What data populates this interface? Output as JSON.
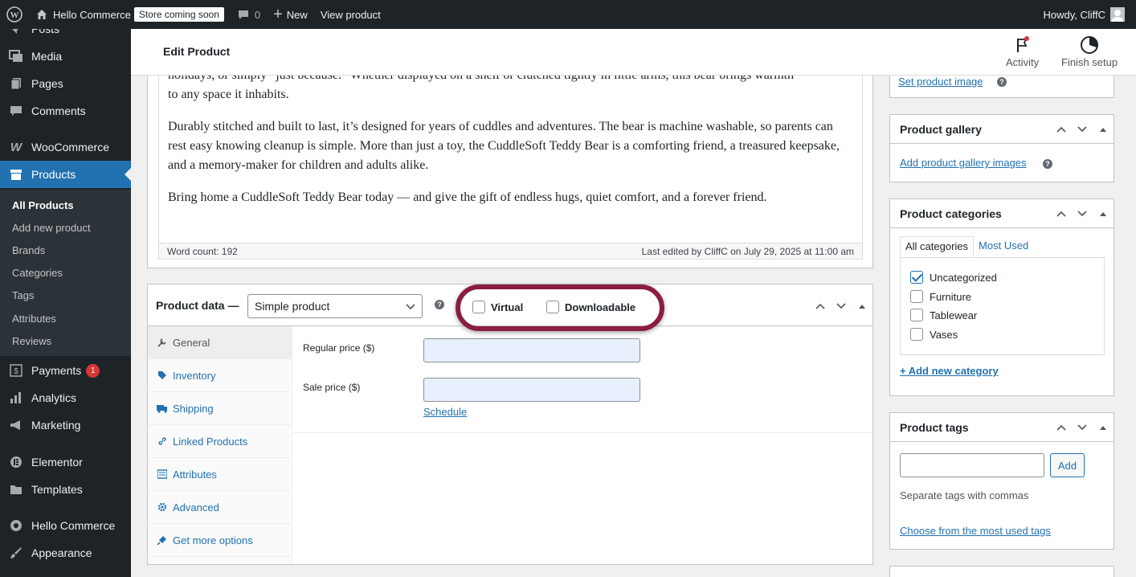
{
  "adminbar": {
    "site_name": "Hello Commerce",
    "store_badge": "Store coming soon",
    "comments_count": "0",
    "new_label": "New",
    "view_product": "View product",
    "howdy": "Howdy, CliffC"
  },
  "sidebar": {
    "items": [
      {
        "label": "Posts",
        "icon": "pin-icon"
      },
      {
        "label": "Media",
        "icon": "media-icon"
      },
      {
        "label": "Pages",
        "icon": "pages-icon"
      },
      {
        "label": "Comments",
        "icon": "comment-icon"
      },
      {
        "label": "WooCommerce",
        "icon": "woo-icon"
      },
      {
        "label": "Products",
        "icon": "archive-icon"
      },
      {
        "label": "Payments",
        "icon": "dollar-icon",
        "badge": "1"
      },
      {
        "label": "Analytics",
        "icon": "chart-bar-icon"
      },
      {
        "label": "Marketing",
        "icon": "megaphone-icon"
      },
      {
        "label": "Elementor",
        "icon": "elementor-icon"
      },
      {
        "label": "Templates",
        "icon": "folder-icon"
      },
      {
        "label": "Hello Commerce",
        "icon": "hello-icon"
      },
      {
        "label": "Appearance",
        "icon": "brush-icon"
      }
    ],
    "submenu": [
      "All Products",
      "Add new product",
      "Brands",
      "Categories",
      "Tags",
      "Attributes",
      "Reviews"
    ]
  },
  "header": {
    "title": "Edit Product",
    "activity": "Activity",
    "finish_setup": "Finish setup"
  },
  "editor": {
    "paragraph_top_cut": "holidays, or simply “just because.” Whether displayed on a shelf or clutched tightly in little arms, this bear brings warmth",
    "paragraph_top_end": "to any space it inhabits.",
    "paragraph_2": "Durably stitched and built to last, it’s designed for years of cuddles and adventures. The bear is machine washable, so parents can rest easy knowing cleanup is simple. More than just a toy, the CuddleSoft Teddy Bear is a comforting friend, a treasured keepsake, and a memory-maker for children and adults alike.",
    "paragraph_3": "Bring home a CuddleSoft Teddy Bear today — and give the gift of endless hugs, quiet comfort, and a forever friend.",
    "word_count": "Word count: 192",
    "last_edited": "Last edited by CliffC on July 29, 2025 at 11:00 am"
  },
  "product_data": {
    "label": "Product data —",
    "type_selected": "Simple product",
    "virtual_label": "Virtual",
    "downloadable_label": "Downloadable",
    "highlight_color": "#8b1e3f",
    "tabs": [
      {
        "label": "General",
        "icon": "wrench-icon"
      },
      {
        "label": "Inventory",
        "icon": "tag-icon"
      },
      {
        "label": "Shipping",
        "icon": "truck-icon"
      },
      {
        "label": "Linked Products",
        "icon": "link-icon"
      },
      {
        "label": "Attributes",
        "icon": "list-icon"
      },
      {
        "label": "Advanced",
        "icon": "gear-icon"
      },
      {
        "label": "Get more options",
        "icon": "plug-icon"
      }
    ],
    "regular_price_label": "Regular price ($)",
    "sale_price_label": "Sale price ($)",
    "schedule_link": "Schedule"
  },
  "product_image": {
    "set_link": "Set product image"
  },
  "gallery": {
    "title": "Product gallery",
    "add_link": "Add product gallery images"
  },
  "categories": {
    "title": "Product categories",
    "tab_all": "All categories",
    "tab_most_used": "Most Used",
    "items": [
      {
        "label": "Uncategorized",
        "checked": true
      },
      {
        "label": "Furniture",
        "checked": false
      },
      {
        "label": "Tablewear",
        "checked": false
      },
      {
        "label": "Vases",
        "checked": false
      }
    ],
    "add_new": "+ Add new category"
  },
  "tags": {
    "title": "Product tags",
    "add_button": "Add",
    "hint": "Separate tags with commas",
    "choose_link": "Choose from the most used tags"
  }
}
